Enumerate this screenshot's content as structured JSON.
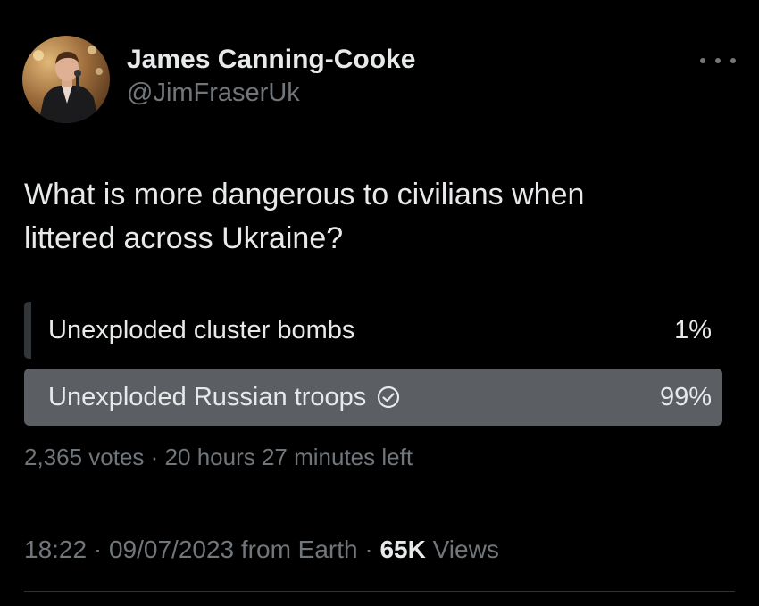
{
  "author": {
    "display_name": "James Canning-Cooke",
    "handle": "@JimFraserUk",
    "avatar_icon": "profile-photo"
  },
  "more_icon": "more-horizontal-icon",
  "tweet": {
    "text_line1": "What is more dangerous to civilians when",
    "text_line2": "littered across Ukraine?"
  },
  "poll": {
    "options": [
      {
        "label": "Unexploded cluster bombs",
        "percent": "1%",
        "fraction": 0.01,
        "selected": false
      },
      {
        "label": "Unexploded Russian troops",
        "percent": "99%",
        "fraction": 0.99,
        "selected": true,
        "icon": "check-circle-icon"
      }
    ],
    "votes": "2,365 votes",
    "separator": " · ",
    "time_left": "20 hours 27 minutes left"
  },
  "meta": {
    "time": "18:22",
    "date": "09/07/2023",
    "source": "from Earth",
    "separator": " · ",
    "views_count": "65K",
    "views_label": "Views"
  },
  "colors": {
    "background": "#000000",
    "primary_text": "#e7e9ea",
    "secondary_text": "#71767b",
    "poll_fill_winner": "#5b5f63",
    "poll_fill_other": "#333639"
  }
}
